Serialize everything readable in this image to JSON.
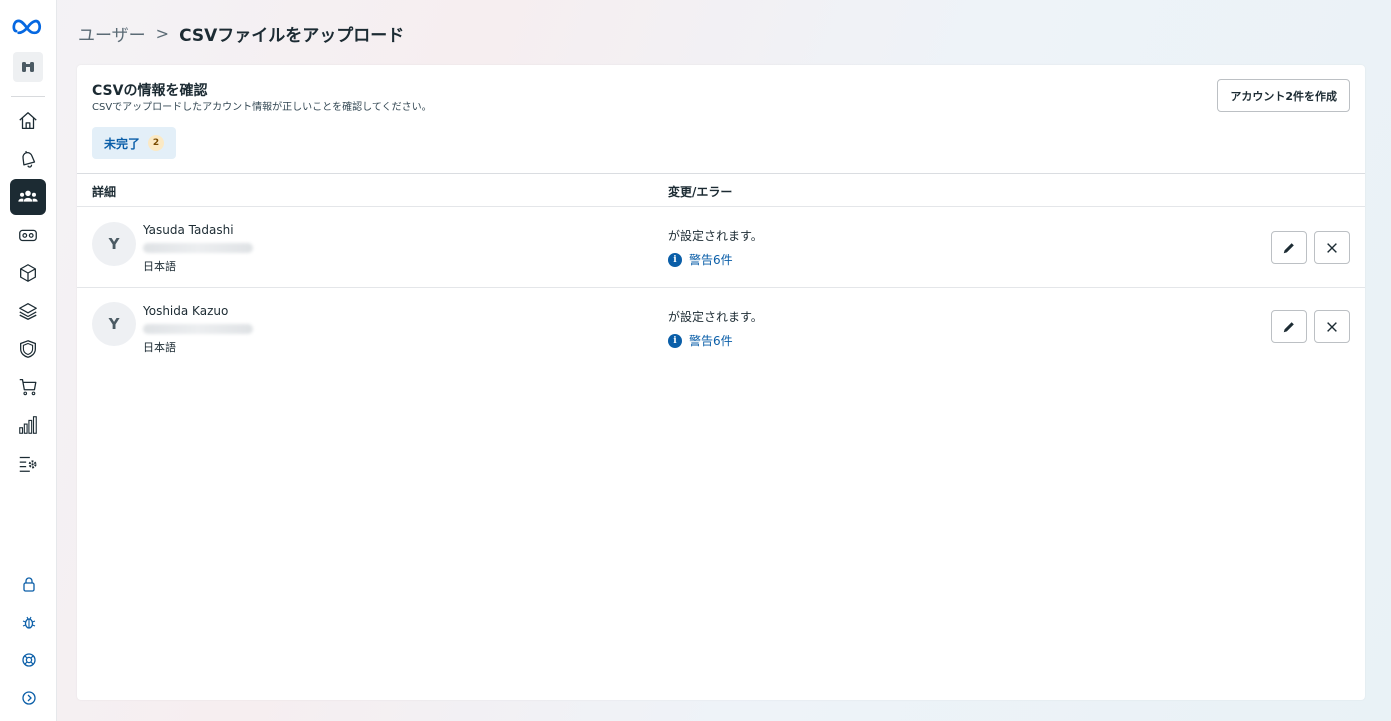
{
  "colors": {
    "accent": "#0a5ea8",
    "text": "#1c2b33",
    "sidebar_active": "#1c2b33",
    "chip_bg": "#e3eff8",
    "count_bg": "#fbe9c4"
  },
  "sidebar": {
    "logo": "meta-logo-icon",
    "org": "binoculars-icon",
    "items": [
      {
        "name": "home-icon"
      },
      {
        "name": "bell-icon"
      },
      {
        "name": "users-icon",
        "active": true
      },
      {
        "name": "vr-headset-icon"
      },
      {
        "name": "cube-icon"
      },
      {
        "name": "layers-icon"
      },
      {
        "name": "shield-icon"
      },
      {
        "name": "cart-icon"
      },
      {
        "name": "bar-chart-icon"
      },
      {
        "name": "list-settings-icon"
      }
    ],
    "bottom": [
      {
        "name": "lock-icon"
      },
      {
        "name": "bug-icon"
      },
      {
        "name": "help-lifebuoy-icon"
      },
      {
        "name": "expand-chevron-icon"
      }
    ]
  },
  "header": {
    "breadcrumb_parent": "ユーザー",
    "breadcrumb_separator": ">",
    "breadcrumb_current": "CSVファイルをアップロード"
  },
  "card": {
    "title": "CSVの情報を確認",
    "subtitle": "CSVでアップロードしたアカウント情報が正しいことを確認してください。",
    "create_button": "アカウント2件を作成",
    "filter": {
      "label": "未完了",
      "count": "2"
    },
    "columns": {
      "detail": "詳細",
      "change": "変更/エラー"
    },
    "rows": [
      {
        "avatar": "Y",
        "name": "Yasuda Tadashi",
        "email": "••••••••••••",
        "language": "日本語",
        "change": "が設定されます。",
        "warning": "警告6件"
      },
      {
        "avatar": "Y",
        "name": "Yoshida Kazuo",
        "email": "••••••••••••",
        "language": "日本語",
        "change": "が設定されます。",
        "warning": "警告6件"
      }
    ]
  }
}
